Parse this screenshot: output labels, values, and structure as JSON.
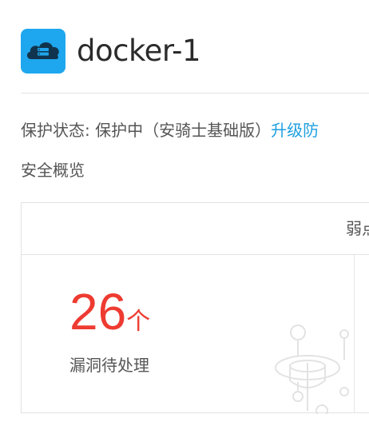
{
  "header": {
    "icon": "cloud-server-icon",
    "title": "docker-1",
    "accent_color": "#1ea7ee"
  },
  "status": {
    "label": "保护状态: ",
    "value": "保护中（安骑士基础版）",
    "upgrade_link": "升级防"
  },
  "overview": {
    "title": "安全概览",
    "table_header": "弱点",
    "vulnerabilities": {
      "count": "26",
      "unit": "个",
      "label": "漏洞待处理",
      "color": "#ee3b31"
    },
    "decoration_icon": "vulnerability-scan-icon"
  }
}
